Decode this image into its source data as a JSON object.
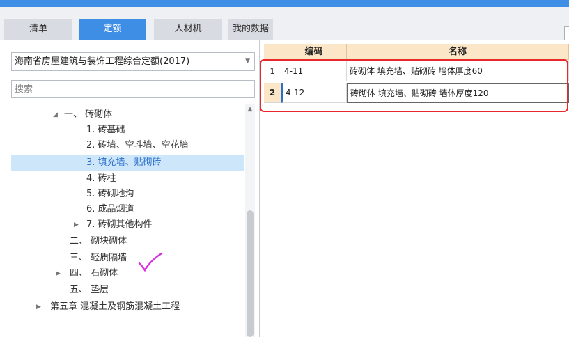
{
  "tabs": [
    {
      "label": "清单",
      "active": false
    },
    {
      "label": "定额",
      "active": true
    },
    {
      "label": "人材机",
      "active": false
    },
    {
      "label": "我的数据",
      "active": false
    }
  ],
  "quota_library": {
    "selected": "海南省房屋建筑与装饰工程综合定额(2017)"
  },
  "search": {
    "placeholder": "搜索"
  },
  "tree": [
    {
      "label": "一、 砖砌体",
      "arrow": "◢"
    },
    {
      "label": "1. 砖基础"
    },
    {
      "label": "2. 砖墙、空斗墙、空花墙"
    },
    {
      "label": "3. 填充墙、贴砌砖",
      "selected": true
    },
    {
      "label": "4. 砖柱"
    },
    {
      "label": "5. 砖砌地沟"
    },
    {
      "label": "6. 成品烟道"
    },
    {
      "label": "7. 砖砌其他构件",
      "arrow": "▶"
    },
    {
      "label": "二、 砌块砌体"
    },
    {
      "label": "三、 轻质隔墙"
    },
    {
      "label": "四、 石砌体",
      "arrow": "▶"
    },
    {
      "label": "五、 垫层"
    },
    {
      "label": "第五章 混凝土及钢筋混凝土工程",
      "arrow": "▶"
    }
  ],
  "grid": {
    "columns": [
      "编码",
      "名称"
    ],
    "rows": [
      {
        "num": "1",
        "code": "4-11",
        "name": "砖砌体 填充墙、贴砌砖 墙体厚度60"
      },
      {
        "num": "2",
        "code": "4-12",
        "name": "砖砌体 填充墙、贴砌砖 墙体厚度120",
        "current": true
      }
    ]
  },
  "colors": {
    "accent": "#3f8ee6",
    "header_bg": "#fbe7c8",
    "selected_bg": "#cde6fa",
    "highlight_box": "#e8292d",
    "checkmark": "#d633e0"
  }
}
